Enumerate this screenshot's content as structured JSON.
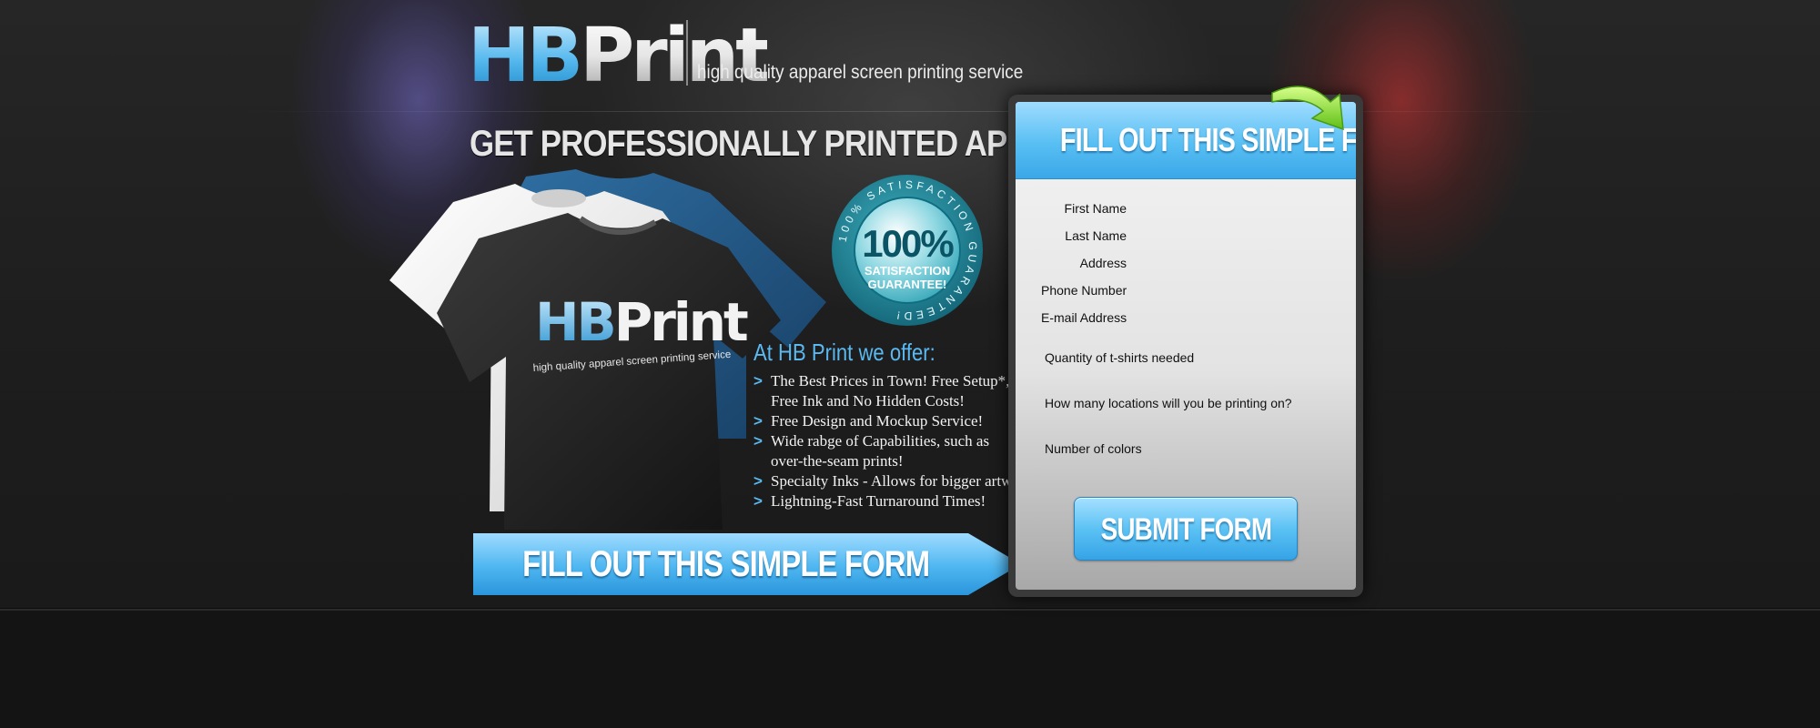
{
  "brand": {
    "logo_hb": "HB",
    "logo_print": "Print",
    "tagline": "high quality apparel screen printing service"
  },
  "headline": "GET PROFESSIONALLY PRINTED APPAREL!",
  "shirt": {
    "logo_hb": "HB",
    "logo_print": "Print",
    "tagline": "high quality apparel screen printing service"
  },
  "badge": {
    "big": "100%",
    "line1": "SATISFACTION",
    "line2": "GUARANTEE!",
    "ring_text": "100% SATISFACTION GUARANTEED!"
  },
  "offers": {
    "title": "At HB Print we offer:",
    "bullet": ">",
    "items": [
      [
        "The Best Prices in Town! Free Setup*,",
        "Free Ink and No Hidden Costs!"
      ],
      [
        "Free Design and Mockup Service!"
      ],
      [
        "Wide rabge of Capabilities, such as",
        "over-the-seam prints!"
      ],
      [
        "Specialty Inks - Allows for bigger artwork!"
      ],
      [
        "Lightning-Fast Turnaround Times!"
      ]
    ]
  },
  "banner": {
    "label": "FILL OUT THIS SIMPLE FORM"
  },
  "form": {
    "header": "FILL OUT  THIS SIMPLE FORM",
    "fields": {
      "first_name": "First Name",
      "last_name": "Last Name",
      "address": "Address",
      "phone": "Phone Number",
      "email": "E-mail Address",
      "quantity": "Quantity of t-shirts needed",
      "locations": "How many locations will you be printing on?",
      "colors": "Number of colors"
    },
    "submit_label": "SUBMIT FORM"
  },
  "colors": {
    "accent_blue": "#5ab9f0",
    "form_header_blue": "#58bff3",
    "arrow_green": "#8fe02a",
    "badge_teal": "#1f8ea0"
  },
  "icons": {
    "form_pointer": "curved-arrow-icon",
    "bullet": "chevron-right-icon"
  }
}
